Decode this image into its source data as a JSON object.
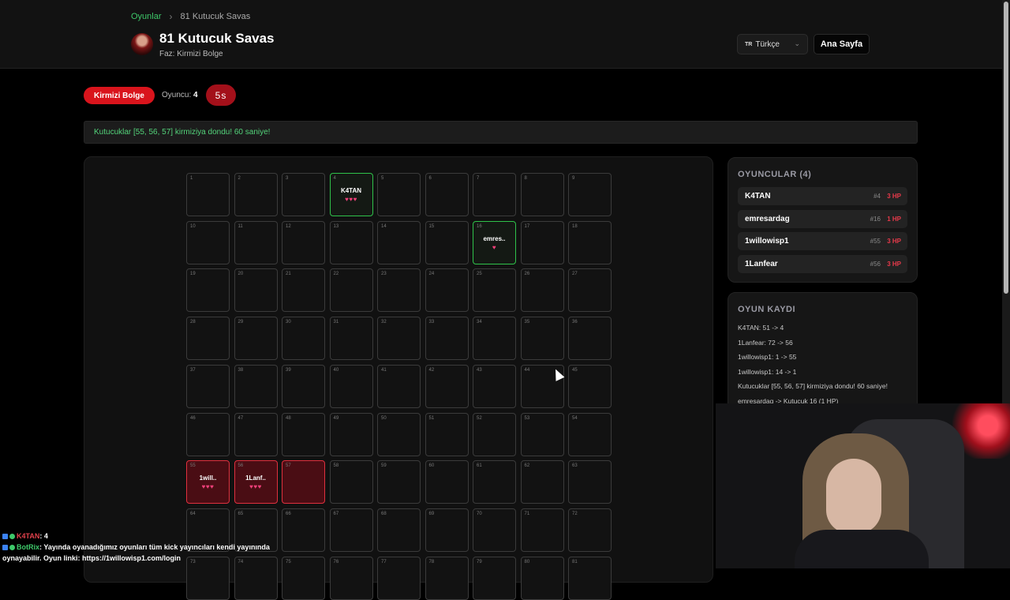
{
  "breadcrumb": {
    "parent": "Oyunlar",
    "separator": "›",
    "current": "81 Kutucuk Savas"
  },
  "header": {
    "title": "81 Kutucuk Savas",
    "phase": "Faz: Kirmizi Bolge",
    "language": {
      "flag": "TR",
      "label": "Türkçe",
      "chevron": "⌄"
    },
    "home_button": "Ana Sayfa"
  },
  "status": {
    "phase_pill": "Kirmizi Bolge",
    "player_count_label": "Oyuncu:",
    "player_count_value": "4",
    "timer": "5s"
  },
  "banner": "Kutucuklar [55, 56, 57] kirmiziya dondu! 60 saniye!",
  "board": {
    "columns": 9,
    "visible_rows": 9,
    "occupied": {
      "4": {
        "name": "K4TAN",
        "hearts": "♥♥♥",
        "state": "green"
      },
      "16": {
        "name": "emres..",
        "hearts": "♥",
        "state": "green"
      },
      "55": {
        "name": "1will..",
        "hearts": "♥♥♥",
        "state": "red"
      },
      "56": {
        "name": "1Lanf..",
        "hearts": "♥♥♥",
        "state": "red"
      },
      "57": {
        "name": "",
        "hearts": "",
        "state": "red"
      }
    }
  },
  "players": {
    "title": "OYUNCULAR (4)",
    "list": [
      {
        "name": "K4TAN",
        "pos": "#4",
        "hp": "3 HP"
      },
      {
        "name": "emresardag",
        "pos": "#16",
        "hp": "1 HP"
      },
      {
        "name": "1willowisp1",
        "pos": "#55",
        "hp": "3 HP"
      },
      {
        "name": "1Lanfear",
        "pos": "#56",
        "hp": "3 HP"
      }
    ]
  },
  "log": {
    "title": "OYUN KAYDI",
    "entries": [
      "K4TAN: 51 -> 4",
      "1Lanfear: 72 -> 56",
      "1willowisp1: 1 -> 55",
      "1willowisp1: 14 -> 1",
      "Kutucuklar [55, 56, 57] kirmiziya dondu! 60 saniye!",
      "emresardag -> Kutucuk 16 (1 HP)"
    ]
  },
  "chat": [
    {
      "user": "K4TAN",
      "text": ": 4"
    },
    {
      "user": "BotRix",
      "text": ": Yayında oyanadığımız oyunları tüm kick yayıncıları kendi yayınında oynayabilir. Oyun linki: https://1willowisp1.com/login"
    }
  ],
  "colors": {
    "accent_green": "#3ec96a",
    "danger_red": "#d9141c",
    "heart_pink": "#f0407a"
  }
}
